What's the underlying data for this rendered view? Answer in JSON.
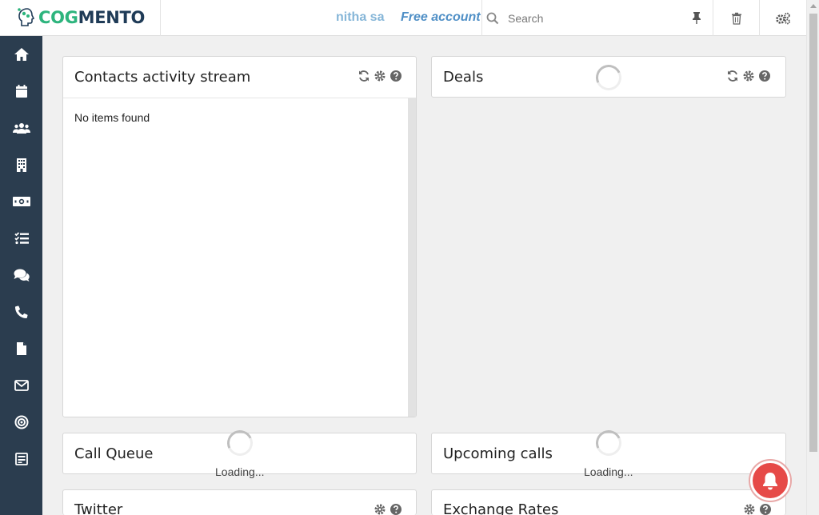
{
  "header": {
    "logo": {
      "cog": "COG",
      "mento": "MENTO"
    },
    "user_name": "nitha sa",
    "account_type": "Free account",
    "search": {
      "placeholder": "Search",
      "value": ""
    }
  },
  "sidebar": {
    "items": [
      {
        "name": "home",
        "icon": "home-icon"
      },
      {
        "name": "calendar",
        "icon": "calendar-icon"
      },
      {
        "name": "contacts",
        "icon": "users-icon"
      },
      {
        "name": "companies",
        "icon": "building-icon"
      },
      {
        "name": "deals",
        "icon": "money-icon"
      },
      {
        "name": "tasks",
        "icon": "tasks-icon"
      },
      {
        "name": "cases",
        "icon": "comments-icon"
      },
      {
        "name": "calls",
        "icon": "phone-icon"
      },
      {
        "name": "documents",
        "icon": "file-icon"
      },
      {
        "name": "email",
        "icon": "envelope-icon"
      },
      {
        "name": "campaigns",
        "icon": "target-icon"
      },
      {
        "name": "forms",
        "icon": "form-icon"
      }
    ]
  },
  "cards": {
    "contacts_activity": {
      "title": "Contacts activity stream",
      "empty_text": "No items found"
    },
    "deals": {
      "title": "Deals"
    },
    "call_queue": {
      "title": "Call Queue",
      "loading_text": "Loading..."
    },
    "upcoming_calls": {
      "title": "Upcoming calls",
      "loading_text": "Loading..."
    },
    "twitter": {
      "title": "Twitter"
    },
    "exchange_rates": {
      "title": "Exchange Rates"
    }
  },
  "colors": {
    "sidebar_bg": "#2b3d4f",
    "brand_green": "#2db47d",
    "brand_navy": "#1f3b57",
    "user_name": "#86b6d8",
    "account": "#4f8fc6",
    "notification": "#e64a48"
  }
}
